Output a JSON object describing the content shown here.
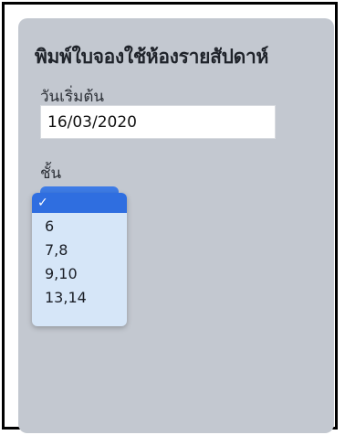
{
  "form": {
    "title": "พิมพ์ใบจองใช้ห้องรายสัปดาห์",
    "start_date_label": "วันเริ่มต้น",
    "start_date_value": "16/03/2020",
    "grade_label": "ชั้น"
  },
  "grade_dropdown": {
    "selected_mark": "✓",
    "options": [
      "6",
      "7,8",
      "9,10",
      "13,14"
    ]
  },
  "colors": {
    "card_bg": "#c3c8d0",
    "dropdown_bg": "#d6e6f8",
    "selected_bg": "#2f6ee0",
    "select_accent": "#3d7be6"
  }
}
